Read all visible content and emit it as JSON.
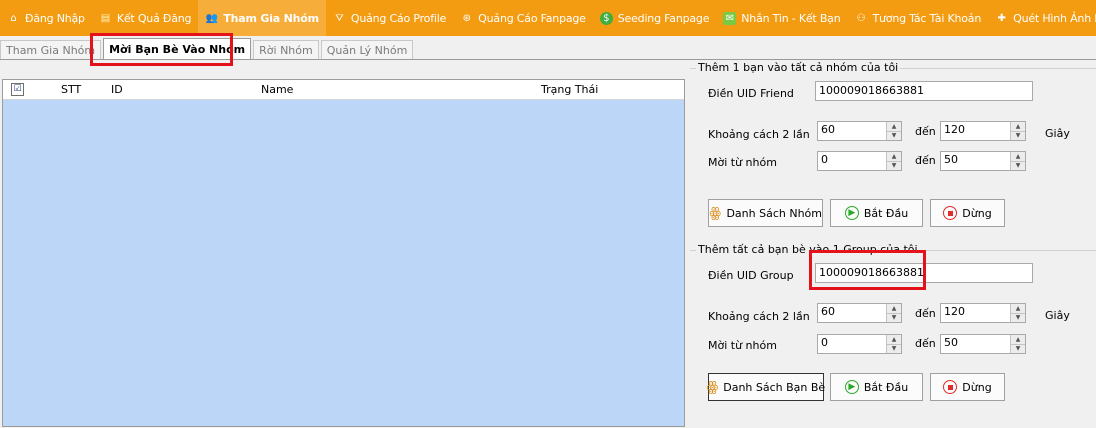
{
  "menu": [
    {
      "label": "Đăng Nhập",
      "icon": "home-icon",
      "glyph": "⌂",
      "color": "#ffffff"
    },
    {
      "label": "Kết Quả Đăng",
      "icon": "document-icon",
      "glyph": "▤",
      "color": "#fff5c0"
    },
    {
      "label": "Tham Gia Nhóm",
      "icon": "group-icon",
      "glyph": "👥",
      "color": "#ffffff",
      "active": true
    },
    {
      "label": "Quảng Cáo Profile",
      "icon": "profile-icon",
      "glyph": "⛛",
      "color": "#ffffff"
    },
    {
      "label": "Quảng Cáo Fanpage",
      "icon": "fanpage-icon",
      "glyph": "⊛",
      "color": "#ffffff"
    },
    {
      "label": "Seeding Fanpage",
      "icon": "dollar-icon",
      "glyph": "$",
      "color": "#3fae3f"
    },
    {
      "label": "Nhắn Tin - Kết Bạn",
      "icon": "sms-icon",
      "glyph": "✉",
      "color": "#7ac943"
    },
    {
      "label": "Tương Tác Tài Khoản",
      "icon": "users-icon",
      "glyph": "⚇",
      "color": "#ffffff"
    },
    {
      "label": "Quét Hình Ảnh Ba",
      "icon": "scan-icon",
      "glyph": "✚",
      "color": "#ffffff"
    }
  ],
  "tabs": [
    "Tham Gia Nhóm",
    "Mời Bạn Bè Vào Nhóm",
    "Rời Nhóm",
    "Quản Lý Nhóm"
  ],
  "grid": {
    "check": "☑",
    "columns": [
      "STT",
      "ID",
      "Name",
      "Trạng Thái"
    ]
  },
  "group1": {
    "title": "Thêm 1 bạn vào tất cả nhóm của tôi",
    "uid_label": "Điền UID Friend",
    "uid_value": "100009018663881",
    "interval_label": "Khoảng cách 2 lần",
    "interval_from": "60",
    "to_label": "đến",
    "interval_to": "120",
    "unit": "Giây",
    "invite_label": "Mời từ nhóm",
    "invite_from": "0",
    "invite_to": "50",
    "btn_list": "Danh Sách Nhóm",
    "btn_start": "Bắt Đầu",
    "btn_stop": "Dừng"
  },
  "group2": {
    "title": "Thêm tất cả bạn bè vào 1 Group của tôi",
    "uid_label": "Điền UID Group",
    "uid_value": "100009018663881",
    "interval_label": "Khoảng cách 2 lần",
    "interval_from": "60",
    "to_label": "đến",
    "interval_to": "120",
    "unit": "Giây",
    "invite_label": "Mời từ nhóm",
    "invite_from": "0",
    "invite_to": "50",
    "btn_list": "Danh Sách Bạn Bè",
    "btn_start": "Bắt Đầu",
    "btn_stop": "Dừng"
  }
}
